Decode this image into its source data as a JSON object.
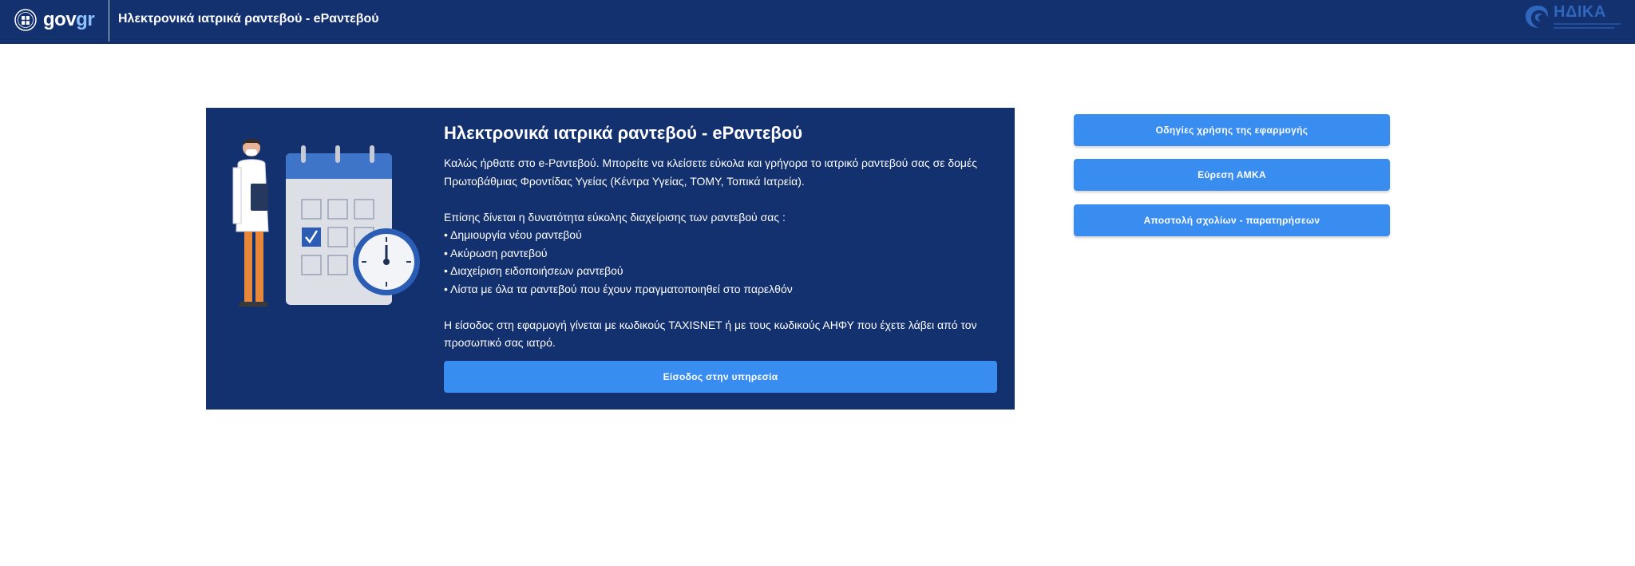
{
  "header": {
    "logo_text_main": "gov",
    "logo_text_accent": "gr",
    "title": "Ηλεκτρονικά ιατρικά ραντεβού - eΡαντεβού",
    "partner_logo_text": "ΗΔΙΚΑ"
  },
  "main": {
    "title": "Ηλεκτρονικά ιατρικά ραντεβού - eΡαντεβού",
    "intro": "Καλώς ήρθατε στο e-Ραντεβού. Μπορείτε να κλείσετε εύκολα και γρήγορα το ιατρικό ραντεβού σας σε δομές Πρωτοβάθμιας Φροντίδας Υγείας (Κέντρα Υγείας, ΤΟΜΥ, Τοπικά Ιατρεία).",
    "features_intro": "Επίσης δίνεται η δυνατότητα εύκολης διαχείρισης των ραντεβού σας :",
    "features": [
      "• Δημιουργία νέου ραντεβού",
      "• Ακύρωση ραντεβού",
      "• Διαχείριση ειδοποιήσεων ραντεβού",
      "• Λίστα με όλα τα ραντεβού που έχουν πραγματοποιηθεί στο παρελθόν"
    ],
    "login_note": "Η είσοδος στη εφαρμογή γίνεται με κωδικούς TAXISNET ή με τους κωδικούς ΑΗΦΥ που έχετε λάβει από τον προσωπικό σας ιατρό.",
    "enter_button": "Είσοδος στην υπηρεσία"
  },
  "side": {
    "buttons": [
      "Οδηγίες χρήσης της εφαρμογής",
      "Εύρεση ΑΜΚΑ",
      "Αποστολή σχολίων - παρατηρήσεων"
    ]
  },
  "colors": {
    "header_bg": "#13306f",
    "card_bg": "#13306f",
    "button_bg": "#3a8df0",
    "text_light": "#ffffff"
  },
  "icons": {
    "emblem": "greek-coat-of-arms-icon",
    "illustration": "doctor-calendar-clock-illustration"
  }
}
